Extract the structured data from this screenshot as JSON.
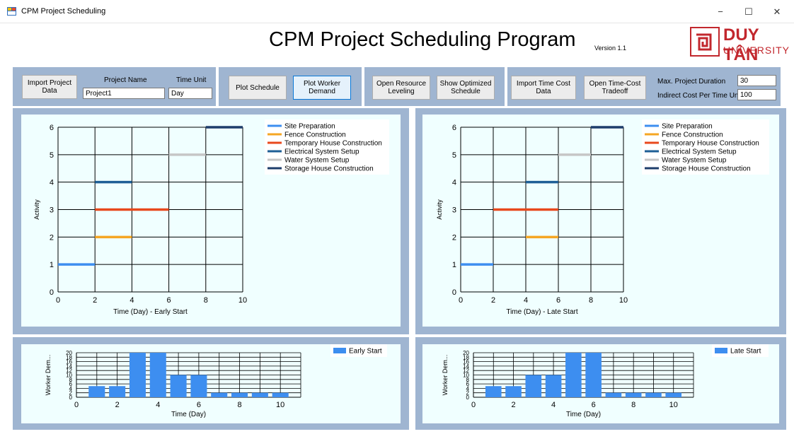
{
  "window": {
    "title": "CPM Project Scheduling",
    "minimize": "−",
    "maximize": "☐",
    "close": "✕"
  },
  "header": {
    "title": "CPM Project Scheduling Program",
    "version": "Version 1.1",
    "logo_main": "DUY TÂN",
    "logo_sub": "UNIVERSITY"
  },
  "toolbar": {
    "import_project": "Import Project\nData",
    "project_name_label": "Project Name",
    "project_name_value": "Project1",
    "time_unit_label": "Time Unit",
    "time_unit_value": "Day",
    "plot_schedule": "Plot Schedule",
    "plot_worker_demand": "Plot Worker\nDemand",
    "open_resource_leveling": "Open Resource\nLeveling",
    "show_optimized_schedule": "Show Optimized\nSchedule",
    "import_time_cost": "Import Time Cost\nData",
    "open_time_cost_tradeoff": "Open Time-Cost\nTradeoff",
    "max_duration_label": "Max. Project Duration",
    "max_duration_value": "30",
    "indirect_cost_label": "Indirect Cost Per Time Unit",
    "indirect_cost_value": "100"
  },
  "colors": {
    "panel": "#9fb5d1",
    "plot_bg": "#f0ffff",
    "bar": "#3d8ef0"
  },
  "chart_data": [
    {
      "type": "gantt",
      "xlabel": "Time (Day) - Early Start",
      "ylabel": "Activity",
      "xlim": [
        0,
        10
      ],
      "ylim": [
        0,
        6
      ],
      "xticks": [
        0,
        2,
        4,
        6,
        8,
        10
      ],
      "yticks": [
        0,
        1,
        2,
        3,
        4,
        5,
        6
      ],
      "grid": true,
      "legend": "top-right",
      "series": [
        {
          "name": "Site Preparation",
          "color": "#3d8ef0",
          "activity": 1,
          "start": 0,
          "end": 2
        },
        {
          "name": "Fence Construction",
          "color": "#f5a623",
          "activity": 2,
          "start": 2,
          "end": 4
        },
        {
          "name": "Temporary House Construction",
          "color": "#e8491d",
          "activity": 3,
          "start": 2,
          "end": 6
        },
        {
          "name": "Electrical System Setup",
          "color": "#1e5f96",
          "activity": 4,
          "start": 2,
          "end": 4
        },
        {
          "name": "Water System Setup",
          "color": "#c6c6c6",
          "activity": 5,
          "start": 6,
          "end": 8
        },
        {
          "name": "Storage House Construction",
          "color": "#1e3d6b",
          "activity": 6,
          "start": 8,
          "end": 10
        }
      ]
    },
    {
      "type": "gantt",
      "xlabel": "Time (Day) - Late Start",
      "ylabel": "Activity",
      "xlim": [
        0,
        10
      ],
      "ylim": [
        0,
        6
      ],
      "xticks": [
        0,
        2,
        4,
        6,
        8,
        10
      ],
      "yticks": [
        0,
        1,
        2,
        3,
        4,
        5,
        6
      ],
      "grid": true,
      "legend": "top-right",
      "series": [
        {
          "name": "Site Preparation",
          "color": "#3d8ef0",
          "activity": 1,
          "start": 0,
          "end": 2
        },
        {
          "name": "Fence Construction",
          "color": "#f5a623",
          "activity": 2,
          "start": 4,
          "end": 6
        },
        {
          "name": "Temporary House Construction",
          "color": "#e8491d",
          "activity": 3,
          "start": 2,
          "end": 6
        },
        {
          "name": "Electrical System Setup",
          "color": "#1e5f96",
          "activity": 4,
          "start": 4,
          "end": 6
        },
        {
          "name": "Water System Setup",
          "color": "#c6c6c6",
          "activity": 5,
          "start": 6,
          "end": 8
        },
        {
          "name": "Storage House Construction",
          "color": "#1e3d6b",
          "activity": 6,
          "start": 8,
          "end": 10
        }
      ]
    },
    {
      "type": "bar",
      "xlabel": "Time (Day)",
      "ylabel": "Worker Dem...",
      "xlim": [
        0,
        11
      ],
      "ylim": [
        0,
        20
      ],
      "xticks": [
        0,
        2,
        4,
        6,
        8,
        10
      ],
      "yticks": [
        0,
        2,
        4,
        6,
        8,
        10,
        12,
        14,
        16,
        18,
        20
      ],
      "grid": true,
      "legend": "top-right",
      "series": [
        {
          "name": "Early Start",
          "x": [
            1,
            2,
            3,
            4,
            5,
            6,
            7,
            8,
            9,
            10
          ],
          "values": [
            5,
            5,
            20,
            20,
            10,
            10,
            2,
            2,
            2,
            2
          ]
        }
      ]
    },
    {
      "type": "bar",
      "xlabel": "Time (Day)",
      "ylabel": "Worker Dem...",
      "xlim": [
        0,
        11
      ],
      "ylim": [
        0,
        20
      ],
      "xticks": [
        0,
        2,
        4,
        6,
        8,
        10
      ],
      "yticks": [
        0,
        2,
        4,
        6,
        8,
        10,
        12,
        14,
        16,
        18,
        20
      ],
      "grid": true,
      "legend": "top-right",
      "series": [
        {
          "name": "Late Start",
          "x": [
            1,
            2,
            3,
            4,
            5,
            6,
            7,
            8,
            9,
            10
          ],
          "values": [
            5,
            5,
            10,
            10,
            20,
            20,
            2,
            2,
            2,
            2
          ]
        }
      ]
    }
  ]
}
